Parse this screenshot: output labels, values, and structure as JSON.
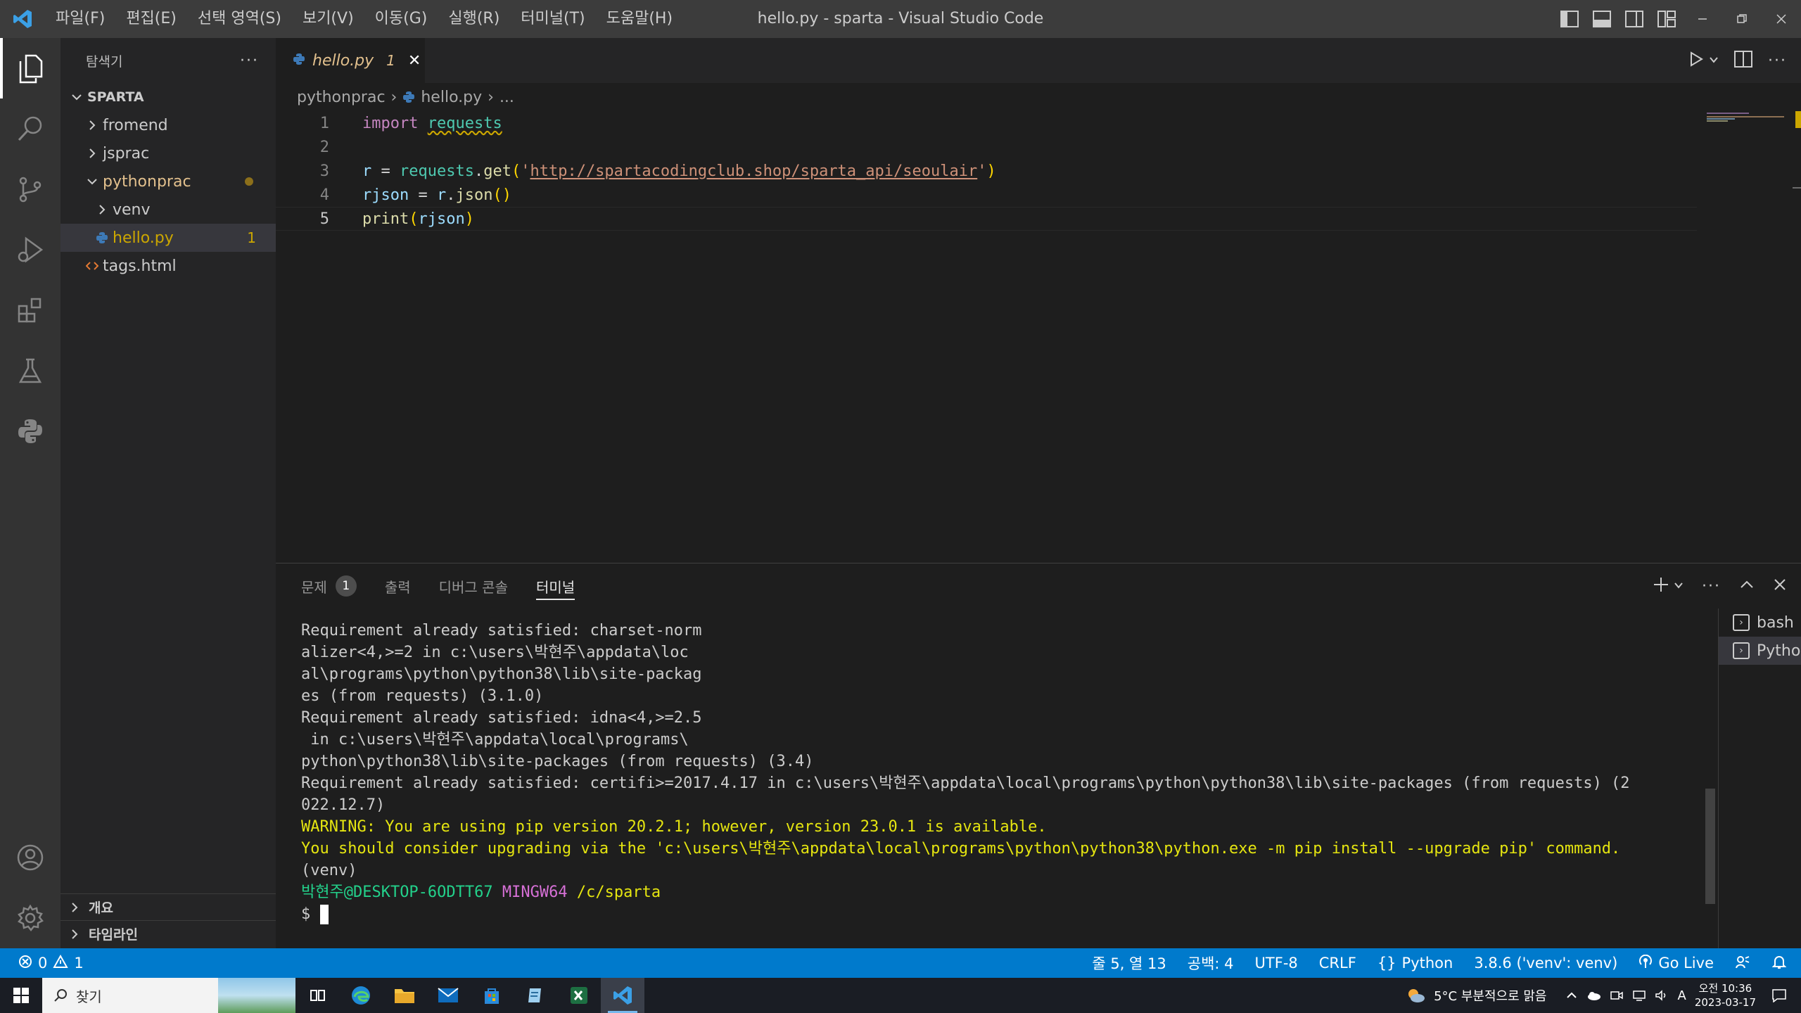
{
  "window": {
    "title": "hello.py - sparta - Visual Studio Code"
  },
  "menu": [
    "파일(F)",
    "편집(E)",
    "선택 영역(S)",
    "보기(V)",
    "이동(G)",
    "실행(R)",
    "터미널(T)",
    "도움말(H)"
  ],
  "sidebar": {
    "title": "탐색기",
    "root": "SPARTA",
    "items": [
      {
        "label": "fromend"
      },
      {
        "label": "jsprac"
      },
      {
        "label": "pythonprac"
      },
      {
        "label": "venv"
      },
      {
        "label": "hello.py",
        "badge": "1"
      },
      {
        "label": "tags.html"
      }
    ],
    "outline": "개요",
    "timeline": "타임라인"
  },
  "editor": {
    "tab": {
      "name": "hello.py",
      "problems": "1"
    },
    "breadcrumb": [
      "pythonprac",
      "hello.py",
      "..."
    ],
    "line_numbers": [
      "1",
      "2",
      "3",
      "4",
      "5"
    ],
    "code": {
      "l1_kw": "import",
      "l1_mod": "requests",
      "l3_var": "r",
      "l3_eq": " = ",
      "l3_mod": "requests",
      "l3_dot": ".",
      "l3_fn": "get",
      "l3_open": "(",
      "l3_q1": "'",
      "l3_url": "http://spartacodingclub.shop/sparta_api/seoulair",
      "l3_q2": "'",
      "l3_close": ")",
      "l4_var": "rjson",
      "l4_eq": " = ",
      "l4_r": "r",
      "l4_dot": ".",
      "l4_fn": "json",
      "l4_paren": "()",
      "l5_fn": "print",
      "l5_open": "(",
      "l5_var": "rjson",
      "l5_close": ")"
    }
  },
  "panel": {
    "tabs": [
      {
        "label": "문제",
        "badge": "1"
      },
      {
        "label": "출력"
      },
      {
        "label": "디버그 콘솔"
      },
      {
        "label": "터미널"
      }
    ],
    "terminal_lines": [
      "Requirement already satisfied: charset-norm",
      "alizer<4,>=2 in c:\\users\\박현주\\appdata\\loc",
      "al\\programs\\python\\python38\\lib\\site-packag",
      "es (from requests) (3.1.0)",
      "Requirement already satisfied: idna<4,>=2.5",
      " in c:\\users\\박현주\\appdata\\local\\programs\\",
      "python\\python38\\lib\\site-packages (from requests) (3.4)",
      "Requirement already satisfied: certifi>=2017.4.17 in c:\\users\\박현주\\appdata\\local\\programs\\python\\python38\\lib\\site-packages (from requests) (2",
      "022.12.7)"
    ],
    "warning_lines": [
      "WARNING: You are using pip version 20.2.1; however, version 23.0.1 is available.",
      "You should consider upgrading via the 'c:\\users\\박현주\\appdata\\local\\programs\\python\\python38\\python.exe -m pip install --upgrade pip' command."
    ],
    "venv_line": "(venv)",
    "prompt": {
      "user": "박현주@DESKTOP-6ODTT67",
      "env": "MINGW64",
      "path": "/c/sparta",
      "symbol": "$ "
    },
    "terminals": [
      "bash",
      "Python"
    ]
  },
  "status": {
    "errors": "0",
    "warnings": "1",
    "position": "줄 5, 열 13",
    "spaces": "공백: 4",
    "encoding": "UTF-8",
    "eol": "CRLF",
    "language": "Python",
    "interpreter": "3.8.6 ('venv': venv)",
    "golive": "Go Live",
    "accent": "#007acc"
  },
  "taskbar": {
    "search": "찾기",
    "weather": "5°C 부분적으로 맑음",
    "time": "오전 10:36",
    "date": "2023-03-17",
    "ime": "A"
  }
}
